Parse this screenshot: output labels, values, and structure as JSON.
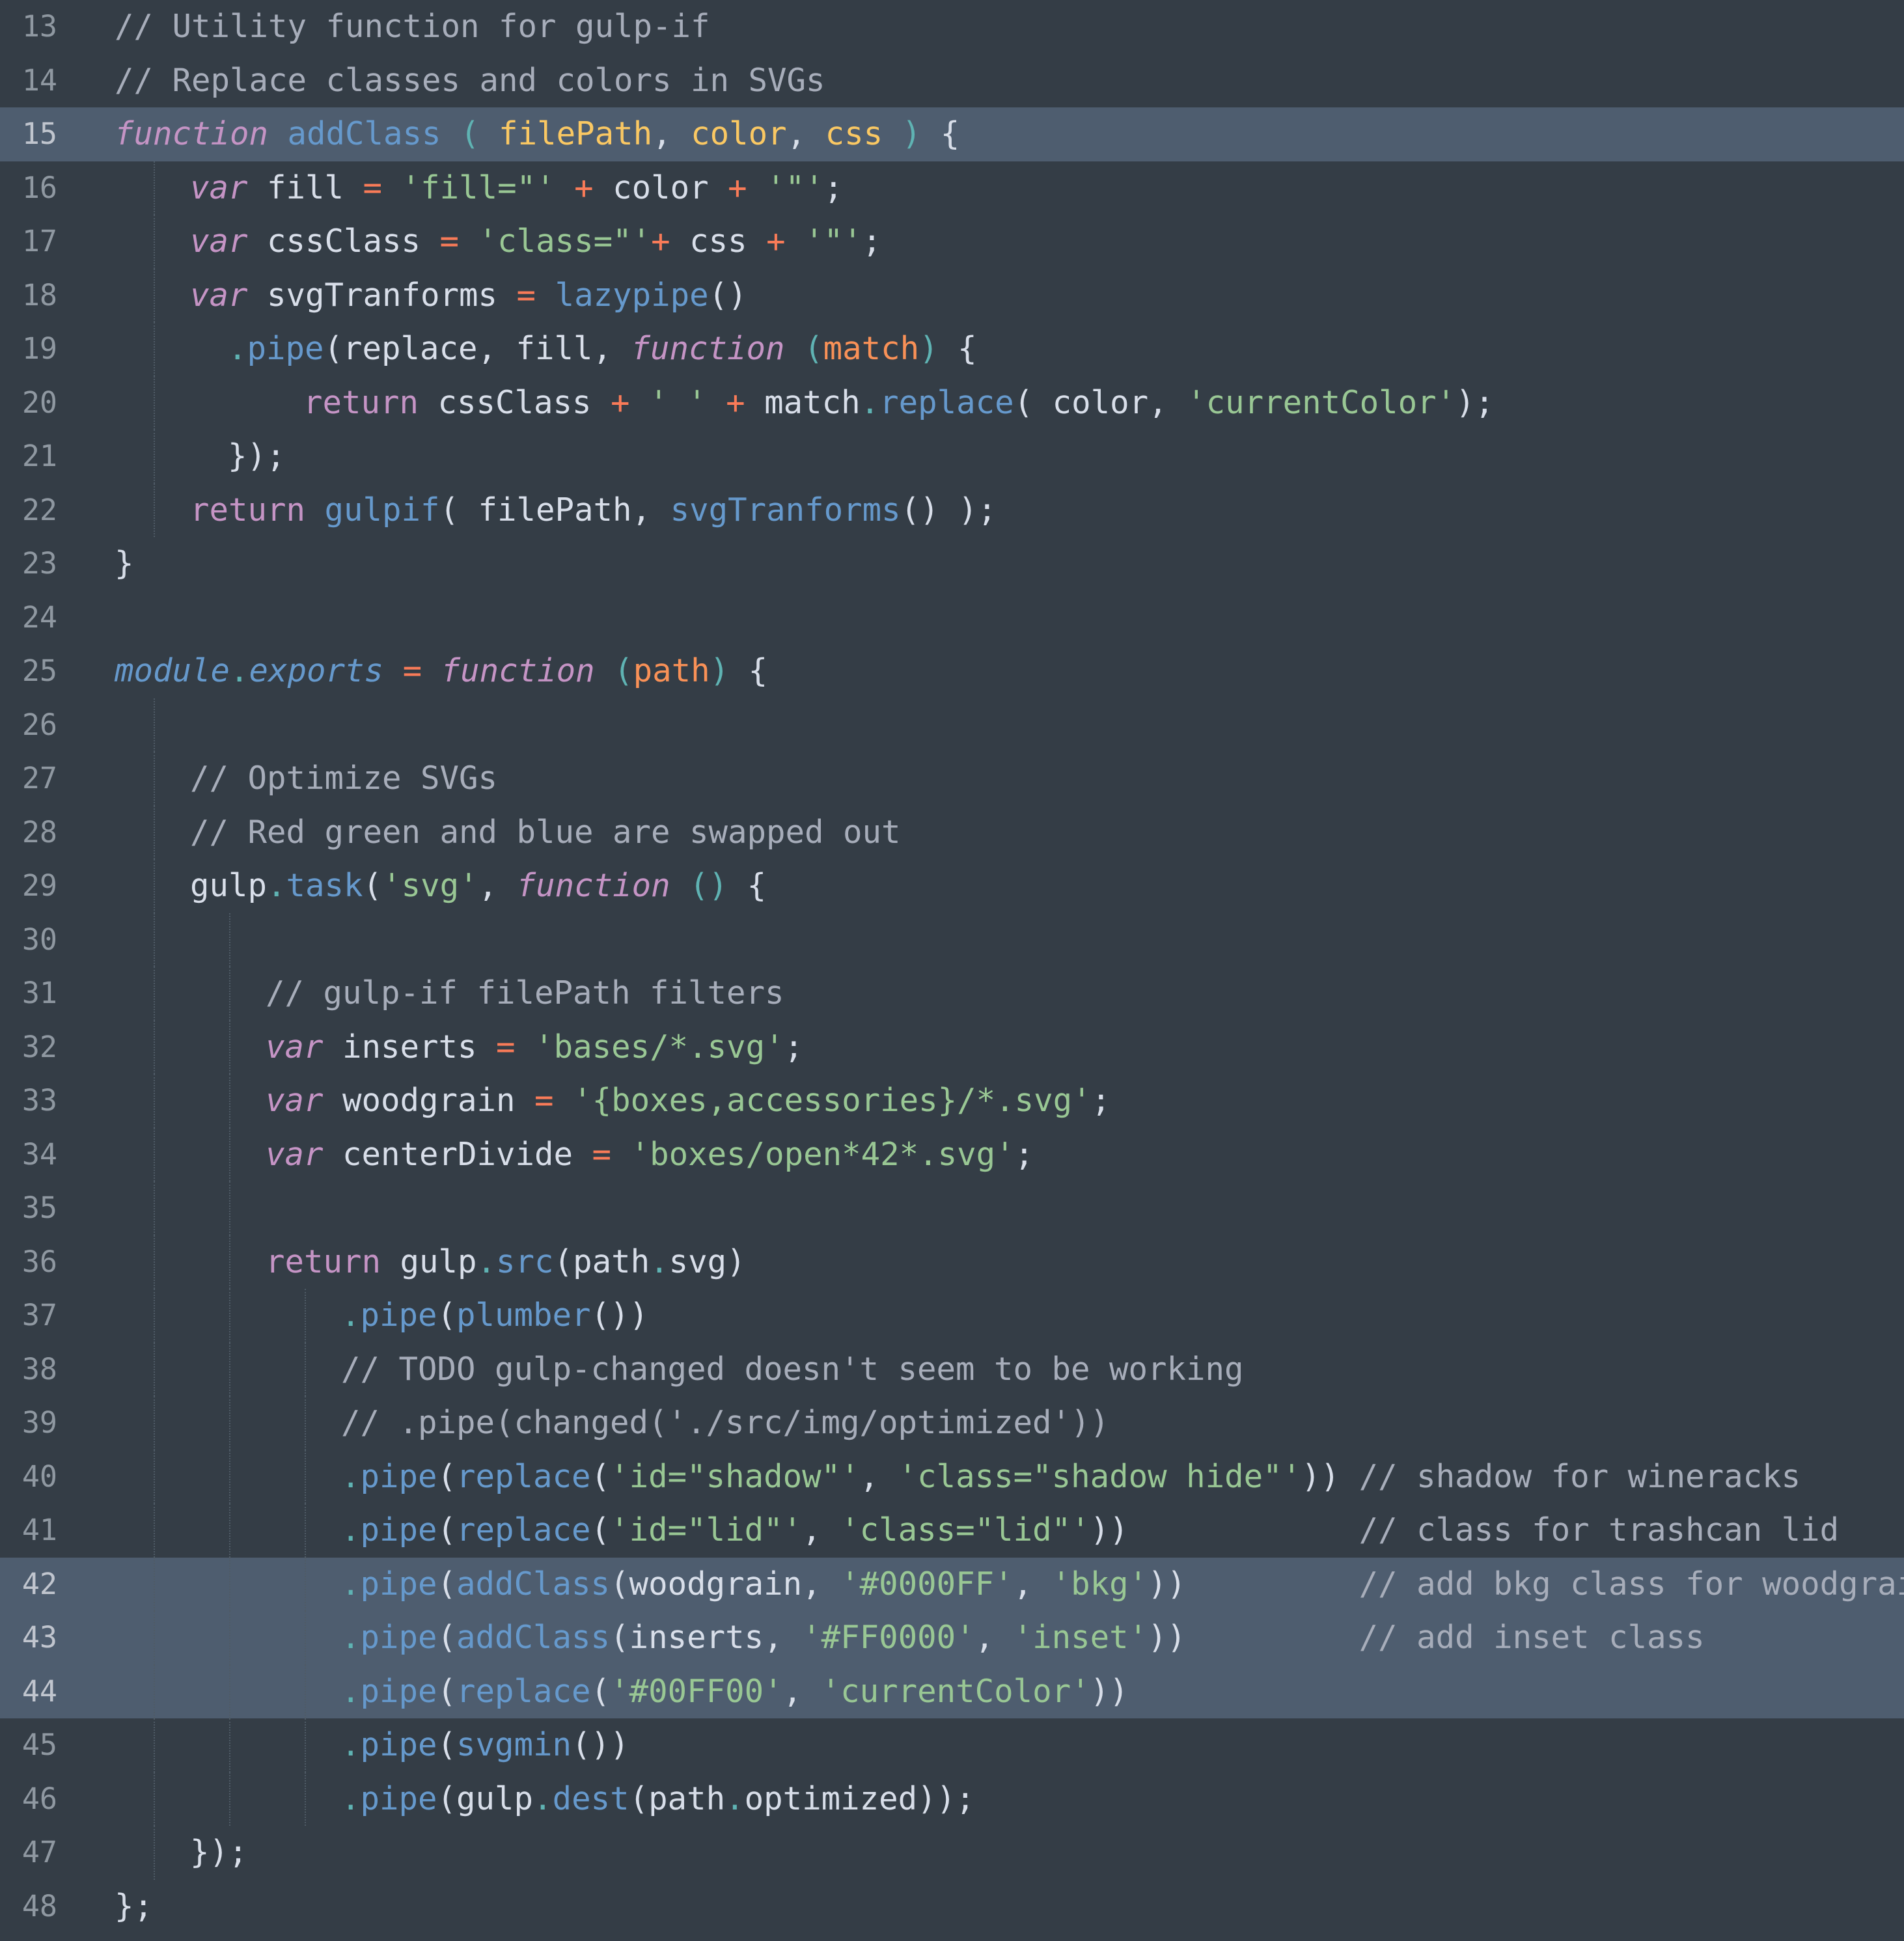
{
  "editor": {
    "theme_colors": {
      "background": "#343d46",
      "highlight": "#4e5d6f",
      "comment": "#a7adba",
      "keyword": "#c594c5",
      "function": "#6699cc",
      "param": "#f99157",
      "string": "#99c794",
      "operator": "#f97b58",
      "punctuation": "#5fb3b3",
      "plain": "#d8dee9"
    },
    "highlighted_lines": [
      15,
      42,
      43,
      44
    ],
    "lines": [
      {
        "num": "13",
        "indent": 0,
        "tokens": [
          {
            "t": "cm",
            "v": "// Utility function for gulp-if"
          }
        ]
      },
      {
        "num": "14",
        "indent": 0,
        "tokens": [
          {
            "t": "cm",
            "v": "// Replace classes and colors in SVGs"
          }
        ]
      },
      {
        "num": "15",
        "indent": 0,
        "tokens": [
          {
            "t": "kw",
            "v": "function"
          },
          {
            "t": "plain",
            "v": " "
          },
          {
            "t": "fn",
            "v": "addClass"
          },
          {
            "t": "plain",
            "v": " "
          },
          {
            "t": "punc",
            "v": "("
          },
          {
            "t": "plain",
            "v": " "
          },
          {
            "t": "param-hl",
            "v": "filePath"
          },
          {
            "t": "plain",
            "v": ", "
          },
          {
            "t": "param-hl",
            "v": "color"
          },
          {
            "t": "plain",
            "v": ", "
          },
          {
            "t": "param-hl",
            "v": "css"
          },
          {
            "t": "plain",
            "v": " "
          },
          {
            "t": "punc",
            "v": ")"
          },
          {
            "t": "plain",
            "v": " {"
          }
        ]
      },
      {
        "num": "16",
        "indent": 1,
        "tokens": [
          {
            "t": "kw",
            "v": "var"
          },
          {
            "t": "plain",
            "v": " fill "
          },
          {
            "t": "op",
            "v": "="
          },
          {
            "t": "plain",
            "v": " "
          },
          {
            "t": "str",
            "v": "'fill=\"'"
          },
          {
            "t": "plain",
            "v": " "
          },
          {
            "t": "op",
            "v": "+"
          },
          {
            "t": "plain",
            "v": " color "
          },
          {
            "t": "op",
            "v": "+"
          },
          {
            "t": "plain",
            "v": " "
          },
          {
            "t": "str",
            "v": "'\"'"
          },
          {
            "t": "plain",
            "v": ";"
          }
        ]
      },
      {
        "num": "17",
        "indent": 1,
        "tokens": [
          {
            "t": "kw",
            "v": "var"
          },
          {
            "t": "plain",
            "v": " cssClass "
          },
          {
            "t": "op",
            "v": "="
          },
          {
            "t": "plain",
            "v": " "
          },
          {
            "t": "str",
            "v": "'class=\"'"
          },
          {
            "t": "op",
            "v": "+"
          },
          {
            "t": "plain",
            "v": " css "
          },
          {
            "t": "op",
            "v": "+"
          },
          {
            "t": "plain",
            "v": " "
          },
          {
            "t": "str",
            "v": "'\"'"
          },
          {
            "t": "plain",
            "v": ";"
          }
        ]
      },
      {
        "num": "18",
        "indent": 1,
        "tokens": [
          {
            "t": "kw",
            "v": "var"
          },
          {
            "t": "plain",
            "v": " svgTranforms "
          },
          {
            "t": "op",
            "v": "="
          },
          {
            "t": "plain",
            "v": " "
          },
          {
            "t": "fn",
            "v": "lazypipe"
          },
          {
            "t": "plain",
            "v": "()"
          }
        ]
      },
      {
        "num": "19",
        "indent": 1.5,
        "tokens": [
          {
            "t": "punc",
            "v": "."
          },
          {
            "t": "fn",
            "v": "pipe"
          },
          {
            "t": "plain",
            "v": "(replace, fill, "
          },
          {
            "t": "kw",
            "v": "function"
          },
          {
            "t": "plain",
            "v": " "
          },
          {
            "t": "punc",
            "v": "("
          },
          {
            "t": "param",
            "v": "match"
          },
          {
            "t": "punc",
            "v": ")"
          },
          {
            "t": "plain",
            "v": " {"
          }
        ]
      },
      {
        "num": "20",
        "indent": 2.5,
        "tokens": [
          {
            "t": "ret",
            "v": "return"
          },
          {
            "t": "plain",
            "v": " cssClass "
          },
          {
            "t": "op",
            "v": "+"
          },
          {
            "t": "plain",
            "v": " "
          },
          {
            "t": "str",
            "v": "' '"
          },
          {
            "t": "plain",
            "v": " "
          },
          {
            "t": "op",
            "v": "+"
          },
          {
            "t": "plain",
            "v": " match"
          },
          {
            "t": "punc",
            "v": "."
          },
          {
            "t": "fn",
            "v": "replace"
          },
          {
            "t": "plain",
            "v": "( color, "
          },
          {
            "t": "str",
            "v": "'currentColor'"
          },
          {
            "t": "plain",
            "v": ");"
          }
        ]
      },
      {
        "num": "21",
        "indent": 1.5,
        "tokens": [
          {
            "t": "plain",
            "v": "});"
          }
        ]
      },
      {
        "num": "22",
        "indent": 1,
        "tokens": [
          {
            "t": "ret",
            "v": "return"
          },
          {
            "t": "plain",
            "v": " "
          },
          {
            "t": "fn",
            "v": "gulpif"
          },
          {
            "t": "plain",
            "v": "( filePath, "
          },
          {
            "t": "fn",
            "v": "svgTranforms"
          },
          {
            "t": "plain",
            "v": "() );"
          }
        ]
      },
      {
        "num": "23",
        "indent": 0,
        "tokens": [
          {
            "t": "plain",
            "v": "}"
          }
        ]
      },
      {
        "num": "24",
        "indent": 0,
        "tokens": []
      },
      {
        "num": "25",
        "indent": 0,
        "tokens": [
          {
            "t": "mod",
            "v": "module"
          },
          {
            "t": "punc",
            "v": "."
          },
          {
            "t": "mod",
            "v": "exports"
          },
          {
            "t": "plain",
            "v": " "
          },
          {
            "t": "op",
            "v": "="
          },
          {
            "t": "plain",
            "v": " "
          },
          {
            "t": "kw",
            "v": "function"
          },
          {
            "t": "plain",
            "v": " "
          },
          {
            "t": "punc",
            "v": "("
          },
          {
            "t": "param",
            "v": "path"
          },
          {
            "t": "punc",
            "v": ")"
          },
          {
            "t": "plain",
            "v": " {"
          }
        ]
      },
      {
        "num": "26",
        "indent": 0,
        "tokens": []
      },
      {
        "num": "27",
        "indent": 1,
        "tokens": [
          {
            "t": "cm",
            "v": "// Optimize SVGs"
          }
        ]
      },
      {
        "num": "28",
        "indent": 1,
        "tokens": [
          {
            "t": "cm",
            "v": "// Red green and blue are swapped out"
          }
        ]
      },
      {
        "num": "29",
        "indent": 1,
        "tokens": [
          {
            "t": "plain",
            "v": "gulp"
          },
          {
            "t": "punc",
            "v": "."
          },
          {
            "t": "fn",
            "v": "task"
          },
          {
            "t": "plain",
            "v": "("
          },
          {
            "t": "str",
            "v": "'svg'"
          },
          {
            "t": "plain",
            "v": ", "
          },
          {
            "t": "kw",
            "v": "function"
          },
          {
            "t": "plain",
            "v": " "
          },
          {
            "t": "punc",
            "v": "()"
          },
          {
            "t": "plain",
            "v": " {"
          }
        ]
      },
      {
        "num": "30",
        "indent": 0,
        "tokens": []
      },
      {
        "num": "31",
        "indent": 2,
        "tokens": [
          {
            "t": "cm",
            "v": "// gulp-if filePath filters"
          }
        ]
      },
      {
        "num": "32",
        "indent": 2,
        "tokens": [
          {
            "t": "kw",
            "v": "var"
          },
          {
            "t": "plain",
            "v": " inserts "
          },
          {
            "t": "op",
            "v": "="
          },
          {
            "t": "plain",
            "v": " "
          },
          {
            "t": "str",
            "v": "'bases/*.svg'"
          },
          {
            "t": "plain",
            "v": ";"
          }
        ]
      },
      {
        "num": "33",
        "indent": 2,
        "tokens": [
          {
            "t": "kw",
            "v": "var"
          },
          {
            "t": "plain",
            "v": " woodgrain "
          },
          {
            "t": "op",
            "v": "="
          },
          {
            "t": "plain",
            "v": " "
          },
          {
            "t": "str",
            "v": "'{boxes,accessories}/*.svg'"
          },
          {
            "t": "plain",
            "v": ";"
          }
        ]
      },
      {
        "num": "34",
        "indent": 2,
        "tokens": [
          {
            "t": "kw",
            "v": "var"
          },
          {
            "t": "plain",
            "v": " centerDivide "
          },
          {
            "t": "op",
            "v": "="
          },
          {
            "t": "plain",
            "v": " "
          },
          {
            "t": "str",
            "v": "'boxes/open*42*.svg'"
          },
          {
            "t": "plain",
            "v": ";"
          }
        ]
      },
      {
        "num": "35",
        "indent": 0,
        "tokens": []
      },
      {
        "num": "36",
        "indent": 2,
        "tokens": [
          {
            "t": "ret",
            "v": "return"
          },
          {
            "t": "plain",
            "v": " gulp"
          },
          {
            "t": "punc",
            "v": "."
          },
          {
            "t": "fn",
            "v": "src"
          },
          {
            "t": "plain",
            "v": "(path"
          },
          {
            "t": "punc",
            "v": "."
          },
          {
            "t": "plain",
            "v": "svg)"
          }
        ]
      },
      {
        "num": "37",
        "indent": 3,
        "tokens": [
          {
            "t": "punc",
            "v": "."
          },
          {
            "t": "fn",
            "v": "pipe"
          },
          {
            "t": "plain",
            "v": "("
          },
          {
            "t": "fn",
            "v": "plumber"
          },
          {
            "t": "plain",
            "v": "())"
          }
        ]
      },
      {
        "num": "38",
        "indent": 3,
        "tokens": [
          {
            "t": "cm",
            "v": "// TODO gulp-changed doesn't seem to be working"
          }
        ]
      },
      {
        "num": "39",
        "indent": 3,
        "tokens": [
          {
            "t": "cm",
            "v": "// .pipe(changed('./src/img/optimized'))"
          }
        ]
      },
      {
        "num": "40",
        "indent": 3,
        "tokens": [
          {
            "t": "punc",
            "v": "."
          },
          {
            "t": "fn",
            "v": "pipe"
          },
          {
            "t": "plain",
            "v": "("
          },
          {
            "t": "fn",
            "v": "replace"
          },
          {
            "t": "plain",
            "v": "("
          },
          {
            "t": "str",
            "v": "'id=\"shadow\"'"
          },
          {
            "t": "plain",
            "v": ", "
          },
          {
            "t": "str",
            "v": "'class=\"shadow hide\"'"
          },
          {
            "t": "plain",
            "v": ")) "
          },
          {
            "t": "cm",
            "v": "// shadow for wineracks"
          }
        ]
      },
      {
        "num": "41",
        "indent": 3,
        "tokens": [
          {
            "t": "punc",
            "v": "."
          },
          {
            "t": "fn",
            "v": "pipe"
          },
          {
            "t": "plain",
            "v": "("
          },
          {
            "t": "fn",
            "v": "replace"
          },
          {
            "t": "plain",
            "v": "("
          },
          {
            "t": "str",
            "v": "'id=\"lid\"'"
          },
          {
            "t": "plain",
            "v": ", "
          },
          {
            "t": "str",
            "v": "'class=\"lid\"'"
          },
          {
            "t": "plain",
            "v": "))            "
          },
          {
            "t": "cm",
            "v": "// class for trashcan lid"
          }
        ]
      },
      {
        "num": "42",
        "indent": 3,
        "tokens": [
          {
            "t": "punc",
            "v": "."
          },
          {
            "t": "fn",
            "v": "pipe"
          },
          {
            "t": "plain",
            "v": "("
          },
          {
            "t": "fn",
            "v": "addClass"
          },
          {
            "t": "plain",
            "v": "(woodgrain, "
          },
          {
            "t": "str",
            "v": "'#0000FF'"
          },
          {
            "t": "plain",
            "v": ", "
          },
          {
            "t": "str",
            "v": "'bkg'"
          },
          {
            "t": "plain",
            "v": "))         "
          },
          {
            "t": "cm",
            "v": "// add bkg class for woodgrain"
          }
        ]
      },
      {
        "num": "43",
        "indent": 3,
        "tokens": [
          {
            "t": "punc",
            "v": "."
          },
          {
            "t": "fn",
            "v": "pipe"
          },
          {
            "t": "plain",
            "v": "("
          },
          {
            "t": "fn",
            "v": "addClass"
          },
          {
            "t": "plain",
            "v": "(inserts, "
          },
          {
            "t": "str",
            "v": "'#FF0000'"
          },
          {
            "t": "plain",
            "v": ", "
          },
          {
            "t": "str",
            "v": "'inset'"
          },
          {
            "t": "plain",
            "v": "))         "
          },
          {
            "t": "cm",
            "v": "// add inset class"
          }
        ]
      },
      {
        "num": "44",
        "indent": 3,
        "tokens": [
          {
            "t": "punc",
            "v": "."
          },
          {
            "t": "fn",
            "v": "pipe"
          },
          {
            "t": "plain",
            "v": "("
          },
          {
            "t": "fn",
            "v": "replace"
          },
          {
            "t": "plain",
            "v": "("
          },
          {
            "t": "str",
            "v": "'#00FF00'"
          },
          {
            "t": "plain",
            "v": ", "
          },
          {
            "t": "str",
            "v": "'currentColor'"
          },
          {
            "t": "plain",
            "v": "))"
          }
        ]
      },
      {
        "num": "45",
        "indent": 3,
        "tokens": [
          {
            "t": "punc",
            "v": "."
          },
          {
            "t": "fn",
            "v": "pipe"
          },
          {
            "t": "plain",
            "v": "("
          },
          {
            "t": "fn",
            "v": "svgmin"
          },
          {
            "t": "plain",
            "v": "())"
          }
        ]
      },
      {
        "num": "46",
        "indent": 3,
        "tokens": [
          {
            "t": "punc",
            "v": "."
          },
          {
            "t": "fn",
            "v": "pipe"
          },
          {
            "t": "plain",
            "v": "(gulp"
          },
          {
            "t": "punc",
            "v": "."
          },
          {
            "t": "fn",
            "v": "dest"
          },
          {
            "t": "plain",
            "v": "(path"
          },
          {
            "t": "punc",
            "v": "."
          },
          {
            "t": "plain",
            "v": "optimized));"
          }
        ]
      },
      {
        "num": "47",
        "indent": 1,
        "tokens": [
          {
            "t": "plain",
            "v": "});"
          }
        ]
      },
      {
        "num": "48",
        "indent": 0,
        "tokens": [
          {
            "t": "plain",
            "v": "};"
          }
        ]
      }
    ]
  }
}
